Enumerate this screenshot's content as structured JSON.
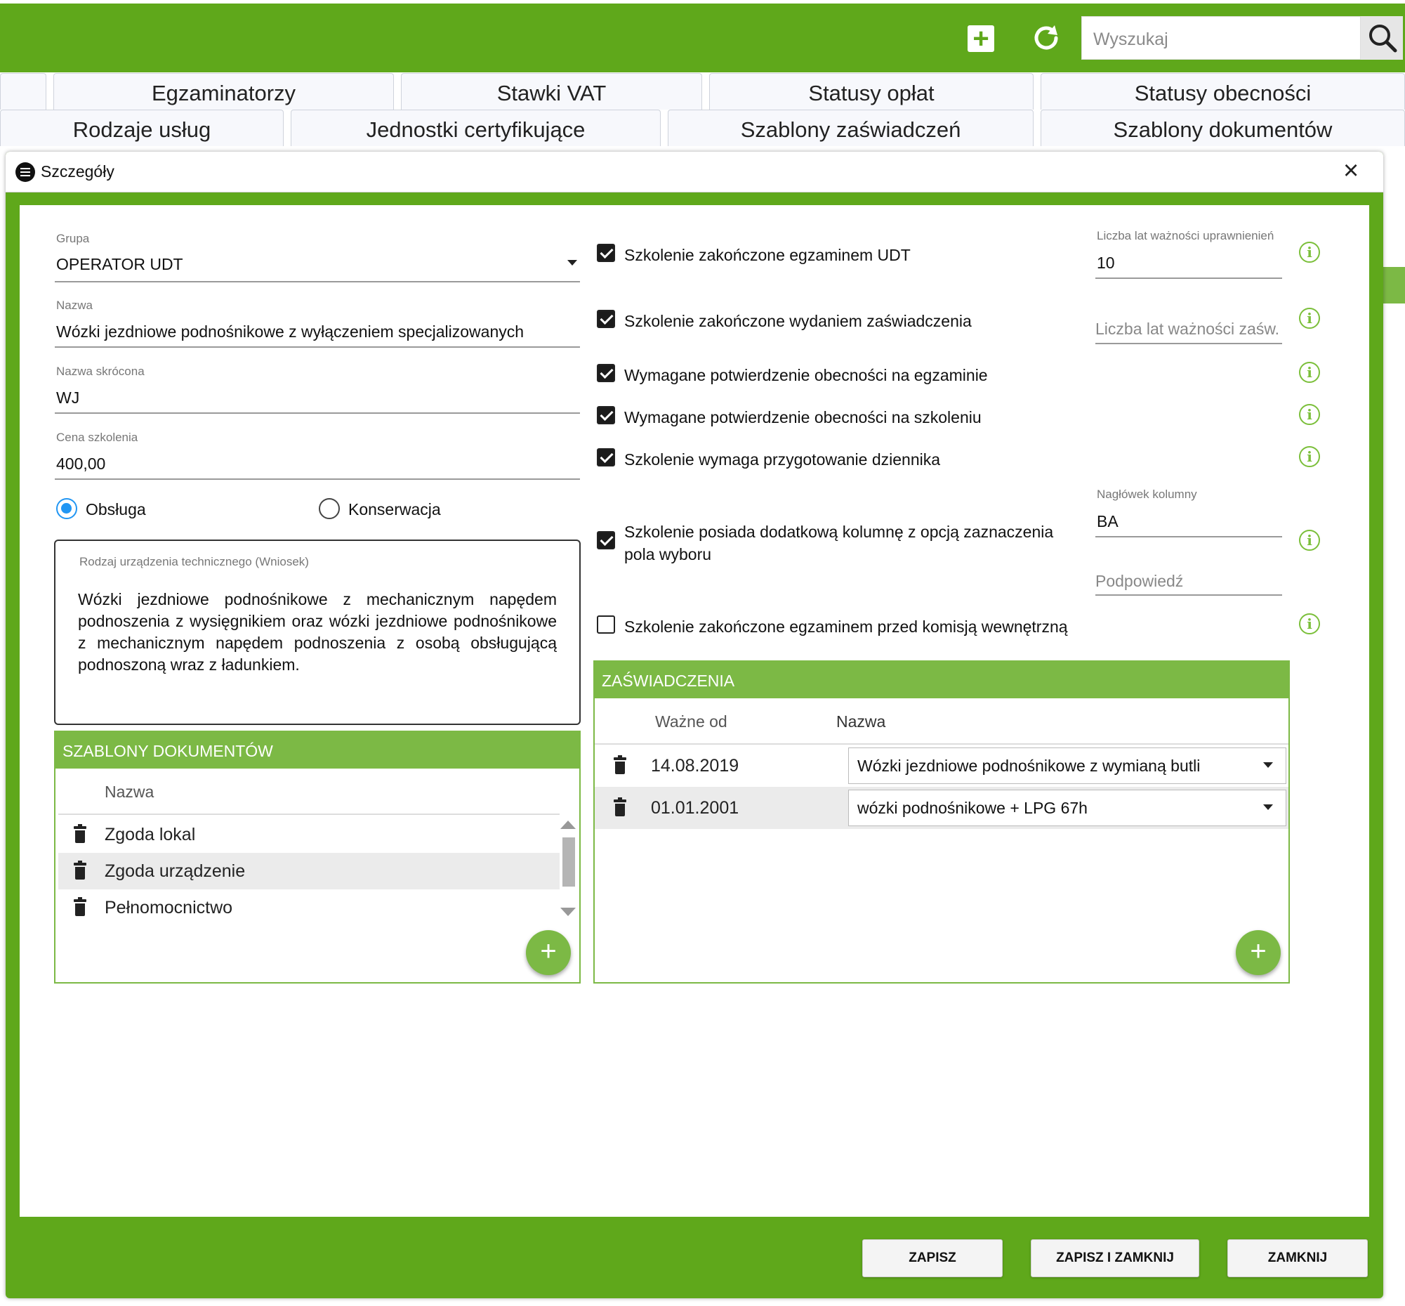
{
  "toolbar": {
    "search_placeholder": "Wyszukaj",
    "add_icon": "plus-square-icon",
    "refresh_icon": "refresh-icon"
  },
  "tabs_row1": [
    "Egzaminatorzy",
    "Stawki VAT",
    "Statusy opłat",
    "Statusy obecności"
  ],
  "tabs_row2": [
    "Rodzaje usług",
    "Jednostki certyfikujące",
    "Szablony zaświadczeń",
    "Szablony dokumentów"
  ],
  "dialog": {
    "title": "Szczegóły"
  },
  "form": {
    "grupa_label": "Grupa",
    "grupa_value": "OPERATOR UDT",
    "nazwa_label": "Nazwa",
    "nazwa_value": "Wózki jezdniowe podnośnikowe z wyłączeniem specjalizowanych",
    "skrot_label": "Nazwa skrócona",
    "skrot_value": "WJ",
    "cena_label": "Cena szkolenia",
    "cena_value": "400,00",
    "radio_obsluga": "Obsługa",
    "radio_konserwacja": "Konserwacja",
    "radio_selected": "Obsługa",
    "rodzaj_label": "Rodzaj urządzenia technicznego (Wniosek)",
    "rodzaj_value": "Wózki jezdniowe podnośnikowe z mechanicznym napędem podnoszenia z wysięgnikiem oraz wózki jezdniowe podnośnikowe z mechanicznym napędem podnoszenia z osobą obsługującą podnoszoną wraz z ładunkiem."
  },
  "checks": [
    {
      "label": "Szkolenie zakończone egzaminem UDT",
      "checked": true
    },
    {
      "label": "Szkolenie zakończone wydaniem zaświadczenia",
      "checked": true
    },
    {
      "label": "Wymagane potwierdzenie obecności na egzaminie",
      "checked": true
    },
    {
      "label": "Wymagane potwierdzenie obecności na szkoleniu",
      "checked": true
    },
    {
      "label": "Szkolenie wymaga przygotowanie dziennika",
      "checked": true
    },
    {
      "label": "Szkolenie posiada dodatkową kolumnę z opcją zaznaczenia pola wyboru",
      "checked": true
    },
    {
      "label": "Szkolenie zakończone egzaminem przed komisją wewnętrzną",
      "checked": false
    }
  ],
  "side_fields": {
    "lata_upr_label": "Liczba lat ważności uprawnienień",
    "lata_upr_value": "10",
    "lata_zasw_placeholder": "Liczba lat ważności zaśw.",
    "naglowek_label": "Nagłówek kolumny",
    "naglowek_value": "BA",
    "podpowiedz_placeholder": "Podpowiedź"
  },
  "szablony": {
    "title": "SZABLONY DOKUMENTÓW",
    "col_name": "Nazwa",
    "rows": [
      "Zgoda lokal",
      "Zgoda urządzenie",
      "Pełnomocnictwo"
    ]
  },
  "zaswiadczenia": {
    "title": "ZAŚWIADCZENIA",
    "col_date": "Ważne od",
    "col_name": "Nazwa",
    "rows": [
      {
        "date": "14.08.2019",
        "name": "Wózki jezdniowe podnośnikowe z wymianą butli"
      },
      {
        "date": "01.01.2001",
        "name": "wózki podnośnikowe + LPG 67h"
      }
    ]
  },
  "buttons": {
    "save": "ZAPISZ",
    "save_close": "ZAPISZ I ZAMKNIJ",
    "close": "ZAMKNIJ"
  },
  "colors": {
    "accent": "#5fa81b",
    "panel_header": "#7cb945"
  }
}
